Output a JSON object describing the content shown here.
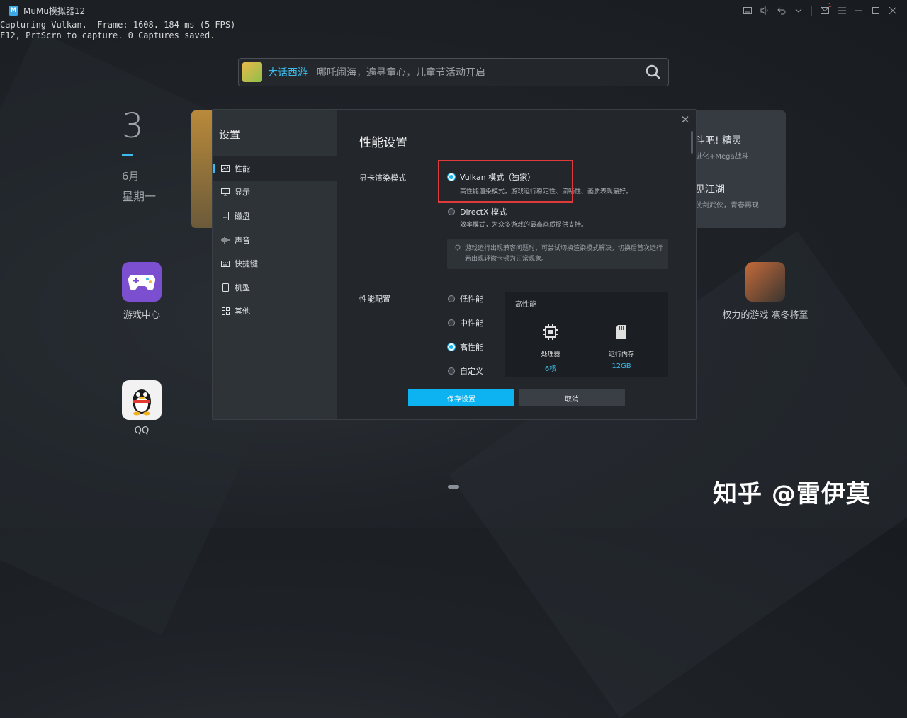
{
  "window": {
    "title": "MuMu模拟器12",
    "logo_text": "M"
  },
  "overlay": {
    "line1": "Capturing Vulkan.  Frame: 1608. 184 ms (5 FPS)",
    "line2": "F12, PrtScrn to capture. 0 Captures saved."
  },
  "titlebar_icons": [
    "keyboard-icon",
    "volume-icon",
    "back-icon",
    "chevron-down-icon",
    "mail-icon",
    "minimize-icon",
    "restore-icon",
    "close-icon"
  ],
  "mail_badge": "1",
  "search": {
    "game": "大话西游",
    "text": "哪吒闹海，遍寻童心，儿童节活动开启"
  },
  "date": {
    "day": "3",
    "month": "6月",
    "weekday": "星期一"
  },
  "banner": {
    "title1": "斗吧! 精灵",
    "sub1": "进化+Mega战斗",
    "title2": "见江湖",
    "sub2": "仗剑武侠，青春再现"
  },
  "apps": [
    {
      "label": "游戏中心"
    },
    {
      "label": "QQ"
    },
    {
      "label": "权力的游戏 凛冬将至"
    }
  ],
  "watermark": "知乎 @雷伊莫",
  "dialog": {
    "title": "设置",
    "nav": [
      {
        "label": "性能",
        "icon": "performance-icon",
        "active": true
      },
      {
        "label": "显示",
        "icon": "display-icon"
      },
      {
        "label": "磁盘",
        "icon": "disk-icon"
      },
      {
        "label": "声音",
        "icon": "sound-icon"
      },
      {
        "label": "快捷键",
        "icon": "keyboard-icon"
      },
      {
        "label": "机型",
        "icon": "phone-icon"
      },
      {
        "label": "其他",
        "icon": "grid-icon"
      }
    ],
    "content_title": "性能设置",
    "render": {
      "label": "显卡渲染模式",
      "options": [
        {
          "label": "Vulkan 模式（独家）",
          "desc": "高性能渲染模式，游戏运行稳定性、流畅性、画质表现最好。",
          "selected": true
        },
        {
          "label": "DirectX 模式",
          "desc": "效率模式，为众多游戏的最高画质提供支持。",
          "selected": false
        }
      ],
      "tip": "游戏运行出现兼容问题时，可尝试切换渲染模式解决，切换后首次运行若出现轻微卡顿为正常现象。"
    },
    "perf": {
      "label": "性能配置",
      "options": [
        {
          "label": "低性能",
          "selected": false
        },
        {
          "label": "中性能",
          "selected": false
        },
        {
          "label": "高性能",
          "selected": true
        },
        {
          "label": "自定义",
          "selected": false
        }
      ],
      "panel_title": "高性能",
      "cpu_label": "处理器",
      "cpu_value": "6核",
      "ram_label": "运行内存",
      "ram_value": "12GB"
    },
    "save_label": "保存设置",
    "cancel_label": "取消"
  },
  "colors": {
    "accent": "#0db3f0",
    "highlight": "#e03a3a"
  }
}
